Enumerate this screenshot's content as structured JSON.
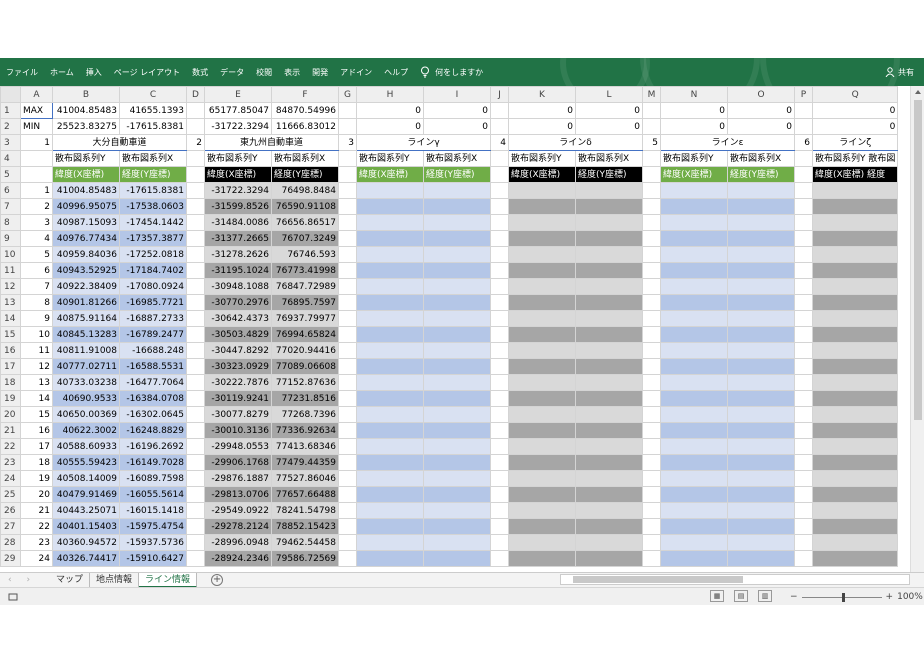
{
  "ribbon": {
    "tabs": [
      "ファイル",
      "ホーム",
      "挿入",
      "ページ レイアウト",
      "数式",
      "データ",
      "校閲",
      "表示",
      "開発",
      "アドイン",
      "ヘルプ"
    ],
    "tell_me": "何をしますか",
    "share": "共有"
  },
  "columns": [
    "A",
    "B",
    "C",
    "D",
    "E",
    "F",
    "G",
    "H",
    "I",
    "J",
    "K",
    "L",
    "M",
    "N",
    "O",
    "P",
    "Q"
  ],
  "row1": {
    "label": "MAX",
    "b": "41004.85483",
    "c": "41655.1393",
    "e": "65177.85047",
    "f": "84870.54996",
    "h": "0",
    "i": "0",
    "k": "0",
    "l": "0",
    "n": "0",
    "o": "0",
    "q": "0"
  },
  "row2": {
    "label": "MIN",
    "b": "25523.83275",
    "c": "-17615.8381",
    "e": "-31722.3294",
    "f": "11666.83012",
    "h": "0",
    "i": "0",
    "k": "0",
    "l": "0",
    "n": "0",
    "o": "0",
    "q": "0"
  },
  "row3": {
    "a": "1",
    "b": "大分自動車道",
    "d": "2",
    "e": "東九州自動車道",
    "g": "3",
    "h": "ラインγ",
    "j": "4",
    "k": "ラインδ",
    "m": "5",
    "n": "ラインε",
    "p": "6",
    "q": "ラインζ"
  },
  "row4": {
    "y": "散布図系列Y",
    "x": "散布図系列X",
    "q_y": "散布図系列Y",
    "q_x": "散布図"
  },
  "row5": {
    "lat": "緯度(X座標)",
    "lon": "経度(Y座標)",
    "q_lat": "緯度(X座標)",
    "q_lon": "経度"
  },
  "rows": [
    {
      "n": "1",
      "b": "41004.85483",
      "c": "-17615.8381",
      "e": "-31722.3294",
      "f": "76498.8484"
    },
    {
      "n": "2",
      "b": "40996.95075",
      "c": "-17538.0603",
      "e": "-31599.8526",
      "f": "76590.91108"
    },
    {
      "n": "3",
      "b": "40987.15093",
      "c": "-17454.1442",
      "e": "-31484.0086",
      "f": "76656.86517"
    },
    {
      "n": "4",
      "b": "40976.77434",
      "c": "-17357.3877",
      "e": "-31377.2665",
      "f": "76707.3249"
    },
    {
      "n": "5",
      "b": "40959.84036",
      "c": "-17252.0818",
      "e": "-31278.2626",
      "f": "76746.593"
    },
    {
      "n": "6",
      "b": "40943.52925",
      "c": "-17184.7402",
      "e": "-31195.1024",
      "f": "76773.41998"
    },
    {
      "n": "7",
      "b": "40922.38409",
      "c": "-17080.0924",
      "e": "-30948.1088",
      "f": "76847.72989"
    },
    {
      "n": "8",
      "b": "40901.81266",
      "c": "-16985.7721",
      "e": "-30770.2976",
      "f": "76895.7597"
    },
    {
      "n": "9",
      "b": "40875.91164",
      "c": "-16887.2733",
      "e": "-30642.4373",
      "f": "76937.79977"
    },
    {
      "n": "10",
      "b": "40845.13283",
      "c": "-16789.2477",
      "e": "-30503.4829",
      "f": "76994.65824"
    },
    {
      "n": "11",
      "b": "40811.91008",
      "c": "-16688.248",
      "e": "-30447.8292",
      "f": "77020.94416"
    },
    {
      "n": "12",
      "b": "40777.02711",
      "c": "-16588.5531",
      "e": "-30323.0929",
      "f": "77089.06608"
    },
    {
      "n": "13",
      "b": "40733.03238",
      "c": "-16477.7064",
      "e": "-30222.7876",
      "f": "77152.87636"
    },
    {
      "n": "14",
      "b": "40690.9533",
      "c": "-16384.0708",
      "e": "-30119.9241",
      "f": "77231.8516"
    },
    {
      "n": "15",
      "b": "40650.00369",
      "c": "-16302.0645",
      "e": "-30077.8279",
      "f": "77268.7396"
    },
    {
      "n": "16",
      "b": "40622.3002",
      "c": "-16248.8829",
      "e": "-30010.3136",
      "f": "77336.92634"
    },
    {
      "n": "17",
      "b": "40588.60933",
      "c": "-16196.2692",
      "e": "-29948.0553",
      "f": "77413.68346"
    },
    {
      "n": "18",
      "b": "40555.59423",
      "c": "-16149.7028",
      "e": "-29906.1768",
      "f": "77479.44359"
    },
    {
      "n": "19",
      "b": "40508.14009",
      "c": "-16089.7598",
      "e": "-29876.1887",
      "f": "77527.86046"
    },
    {
      "n": "20",
      "b": "40479.91469",
      "c": "-16055.5614",
      "e": "-29813.0706",
      "f": "77657.66488"
    },
    {
      "n": "21",
      "b": "40443.25071",
      "c": "-16015.1418",
      "e": "-29549.0922",
      "f": "78241.54798"
    },
    {
      "n": "22",
      "b": "40401.15403",
      "c": "-15975.4754",
      "e": "-29278.2124",
      "f": "78852.15423"
    },
    {
      "n": "23",
      "b": "40360.94572",
      "c": "-15937.5736",
      "e": "-28996.0948",
      "f": "79462.54458"
    },
    {
      "n": "24",
      "b": "40326.74417",
      "c": "-15910.6427",
      "e": "-28924.2346",
      "f": "79586.72569"
    }
  ],
  "sheet_tabs": [
    "マップ",
    "地点情報",
    "ライン情報"
  ],
  "active_tab": "ライン情報",
  "add_sheet": "+",
  "zoom_minus": "−",
  "zoom_plus": "+",
  "zoom": "100%",
  "colors": {
    "ribbon": "#217346",
    "green_header": "#70ad47",
    "light_blue": "#d9e1f2",
    "dark_blue": "#b4c6e7",
    "light_grey": "#d9d9d9",
    "dark_grey": "#a6a6a6"
  }
}
